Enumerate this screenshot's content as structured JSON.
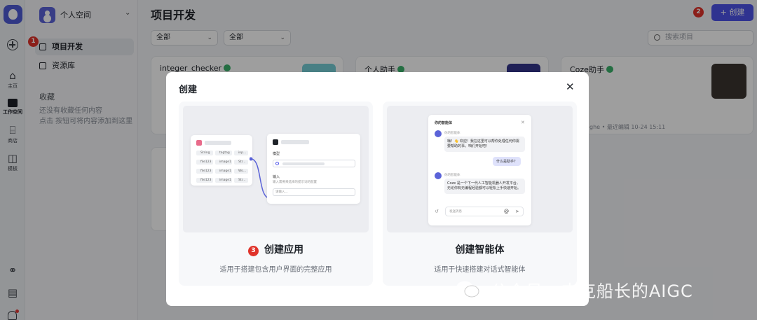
{
  "rail": {
    "items": [
      {
        "label": "主页"
      },
      {
        "label": "工作空间"
      },
      {
        "label": "商店"
      },
      {
        "label": "模板"
      }
    ]
  },
  "sidebar": {
    "space_name": "个人空间",
    "nav": [
      {
        "label": "项目开发",
        "badge": "1"
      },
      {
        "label": "资源库"
      }
    ],
    "favorites_title": "收藏",
    "favorites_desc": "还没有收藏任何内容\n点击   按钮可将内容添加到这里"
  },
  "header": {
    "title": "项目开发",
    "create_label": "+ 创建",
    "create_badge": "2"
  },
  "filters": {
    "select1": "全部",
    "select2": "全部",
    "search_placeholder": "搜索项目"
  },
  "cards": [
    {
      "title": "integer_checker"
    },
    {
      "title": "个人助手"
    },
    {
      "title": "Coze助手",
      "meta": "ghe • 最近编辑 10-24 15:11"
    }
  ],
  "modal": {
    "title": "创建",
    "options": [
      {
        "title": "创建应用",
        "badge": "3",
        "desc": "适用于搭建包含用户界面的完整应用",
        "preview": {
          "model_label": "模型",
          "input_label": "输入",
          "input_hint": "输入需要来选择的提示词的配置",
          "input_placeholder": "请输入...",
          "tags": [
            "String",
            "tagtag",
            "inp...",
            "file123",
            "image1",
            "Str...",
            "file123",
            "image1",
            "Wo...",
            "file123",
            "image1",
            "Str..."
          ]
        }
      },
      {
        "title": "创建智能体",
        "desc": "适用于快速搭建对话式智能体",
        "preview": {
          "chat_title": "你的智能体",
          "bot_name": "你的智能体",
          "msg1": "嗨！👋 欢迎！我在这里可以帮你处理任何你需要帮助的事。咱们开始吧！",
          "user_msg": "什么是助手？",
          "msg2": "Coze 是一个下一代人工智能机器人开发平台。无论你有无编程经验都可以轻松上手快速开始。",
          "input_placeholder": "发送消息"
        }
      }
    ]
  },
  "watermark": "公众号 · 杰克船长的AIGC",
  "colors": {
    "accent": "#4d53e8",
    "badge": "#e0322a",
    "success": "#3ab26b"
  }
}
